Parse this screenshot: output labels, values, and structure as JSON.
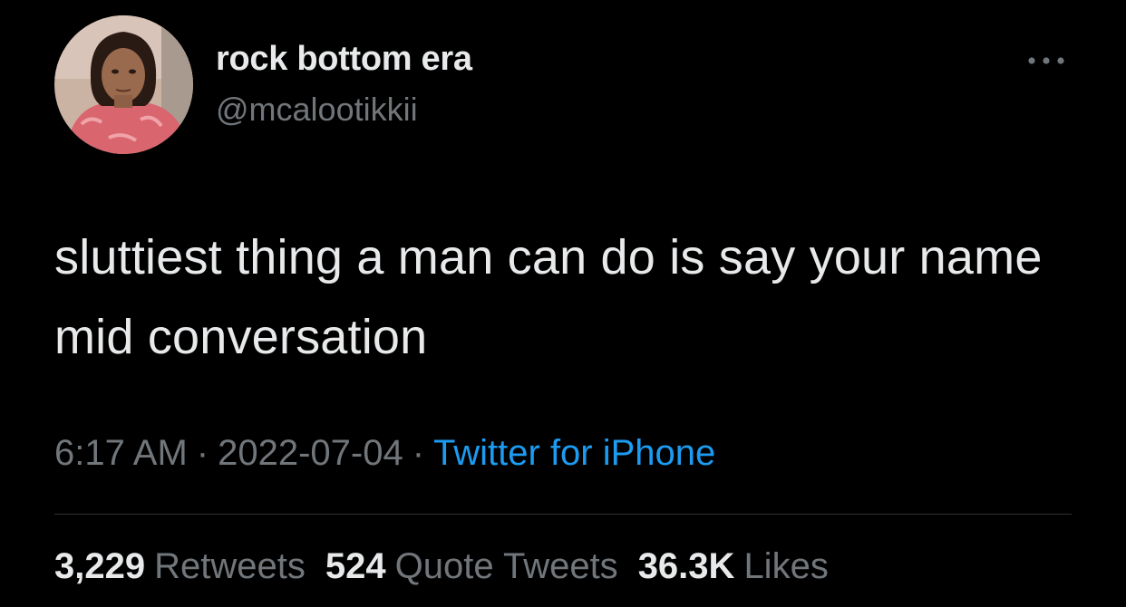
{
  "user": {
    "display_name": "rock bottom era",
    "handle": "@mcalootikkii",
    "avatar_icon": "profile-photo"
  },
  "more_icon": "more-horizontal-icon",
  "tweet": {
    "text": "sluttiest thing a man can do is say your name mid conversation"
  },
  "meta": {
    "time": "6:17 AM",
    "separator": "·",
    "date": "2022-07-04",
    "source": "Twitter for iPhone"
  },
  "stats": {
    "retweets_count": "3,229",
    "retweets_label": "Retweets",
    "quote_count": "524",
    "quote_label": "Quote Tweets",
    "likes_count": "36.3K",
    "likes_label": "Likes"
  },
  "colors": {
    "background": "#000000",
    "primary_text": "#e7e9ea",
    "secondary_text": "#71767b",
    "link": "#1d9bf0",
    "divider": "#2f3336"
  }
}
